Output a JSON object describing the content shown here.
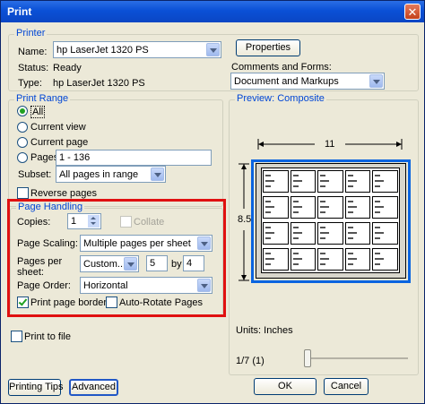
{
  "window": {
    "title": "Print",
    "close_glyph": "✕"
  },
  "printer": {
    "group_label": "Printer",
    "name_label": "Name:",
    "name_value": "hp LaserJet 1320 PS",
    "properties_button": "Properties",
    "status_label": "Status:",
    "status_value": "Ready",
    "type_label": "Type:",
    "type_value": "hp LaserJet 1320 PS",
    "comments_label": "Comments and Forms:",
    "comments_value": "Document and Markups"
  },
  "print_range": {
    "group_label": "Print Range",
    "all": "All",
    "current_view": "Current view",
    "current_page": "Current page",
    "pages": "Pages",
    "pages_value": "1 - 136",
    "subset_label": "Subset:",
    "subset_value": "All pages in range",
    "reverse_pages": "Reverse pages",
    "selected": "All"
  },
  "page_handling": {
    "group_label": "Page Handling",
    "copies_label": "Copies:",
    "copies_value": "1",
    "collate_label": "Collate",
    "scaling_label": "Page Scaling:",
    "scaling_value": "Multiple pages per sheet",
    "pages_per_sheet_label_1": "Pages per",
    "pages_per_sheet_label_2": "sheet:",
    "pages_per_sheet_value": "Custom...",
    "cols_value": "5",
    "by_label": "by",
    "rows_value": "4",
    "order_label": "Page Order:",
    "order_value": "Horizontal",
    "print_page_border": "Print page border",
    "print_page_border_checked": true,
    "auto_rotate": "Auto-Rotate Pages",
    "auto_rotate_checked": false
  },
  "preview": {
    "group_label": "Preview: Composite",
    "width_label": "11",
    "height_label": "8.5",
    "units": "Units: Inches",
    "page_indicator": "1/7 (1)",
    "grid_cols": 5,
    "grid_rows": 4
  },
  "print_to_file": "Print to file",
  "buttons": {
    "printing_tips": "Printing Tips",
    "advanced": "Advanced",
    "ok": "OK",
    "cancel": "Cancel"
  }
}
